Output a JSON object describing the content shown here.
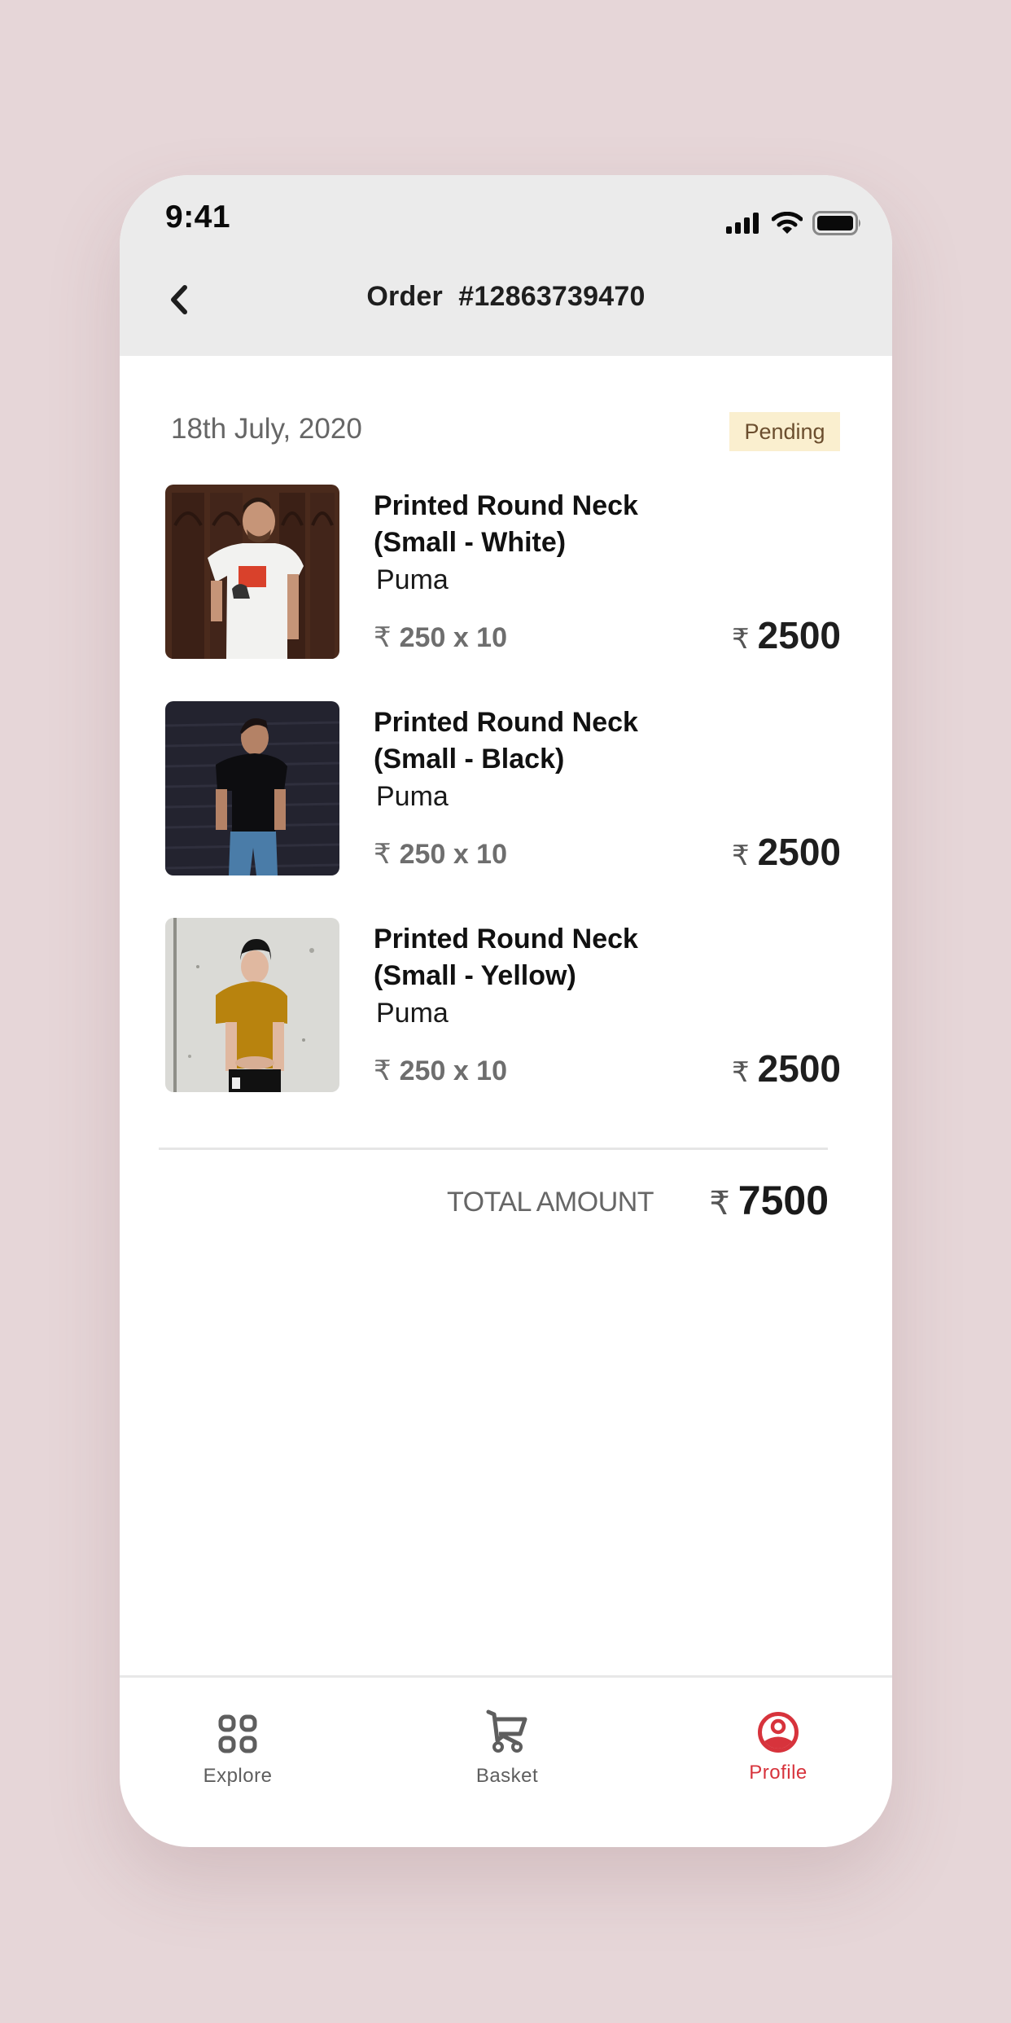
{
  "status_bar": {
    "time": "9:41",
    "icons": [
      "signal-icon",
      "wifi-icon",
      "battery-icon"
    ]
  },
  "header": {
    "back_icon": "chevron-left-icon",
    "title": "Order  #12863739470"
  },
  "order": {
    "date": "18th July, 2020",
    "status": "Pending",
    "status_colors": {
      "background": "#FAEFCF",
      "text": "#6B4E2E"
    },
    "currency_symbol": "₹",
    "items": [
      {
        "name_line1": "Printed Round Neck",
        "name_line2": "(Small - White)",
        "brand": "Puma",
        "unit_price": "250 x 10",
        "line_total": "2500",
        "image": "man-in-white-tshirt-photo"
      },
      {
        "name_line1": "Printed Round Neck",
        "name_line2": "(Small - Black)",
        "brand": "Puma",
        "unit_price": "250 x 10",
        "line_total": "2500",
        "image": "man-in-black-tshirt-photo"
      },
      {
        "name_line1": "Printed Round Neck",
        "name_line2": "(Small - Yellow)",
        "brand": "Puma",
        "unit_price": "250 x 10",
        "line_total": "2500",
        "image": "man-in-yellow-tshirt-photo"
      }
    ],
    "total_label": "TOTAL AMOUNT",
    "total_value": "7500"
  },
  "bottom_nav": {
    "items": [
      {
        "label": "Explore",
        "icon": "grid-icon",
        "active": false
      },
      {
        "label": "Basket",
        "icon": "cart-icon",
        "active": false
      },
      {
        "label": "Profile",
        "icon": "profile-icon",
        "active": true
      }
    ],
    "active_color": "#D7333C",
    "inactive_color": "#5E5E5E"
  }
}
